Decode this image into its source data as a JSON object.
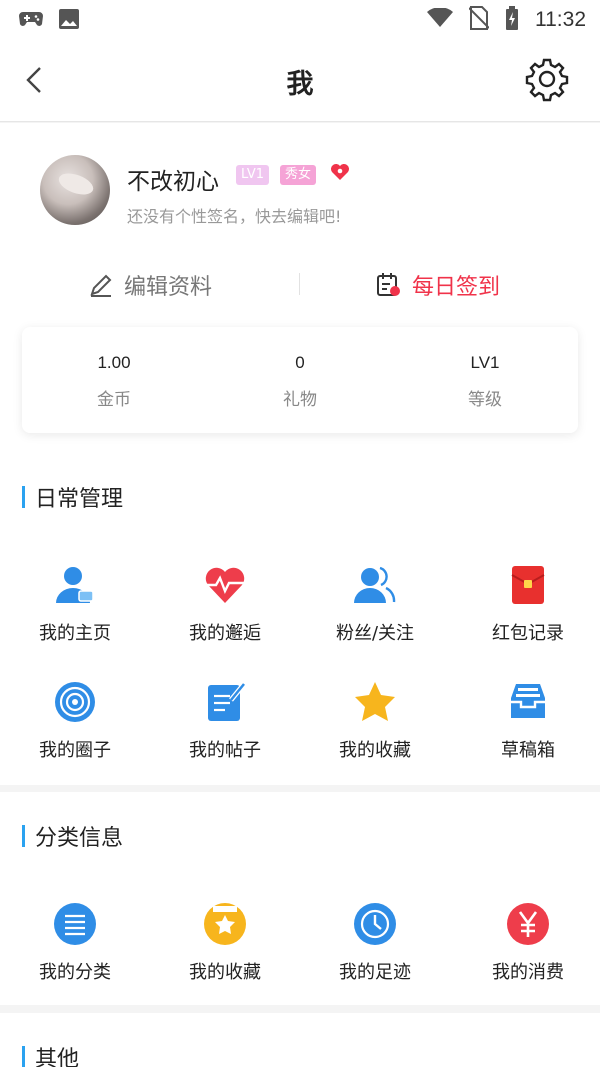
{
  "status_bar": {
    "time": "11:32"
  },
  "header": {
    "title": "我"
  },
  "profile": {
    "name": "不改初心",
    "level_badge": "LV1",
    "gender_badge": "秀女",
    "signature": "还没有个性签名，快去编辑吧!",
    "edit_label": "编辑资料",
    "checkin_label": "每日签到",
    "stats": [
      {
        "value": "1.00",
        "label": "金币"
      },
      {
        "value": "0",
        "label": "礼物"
      },
      {
        "value": "LV1",
        "label": "等级"
      }
    ]
  },
  "daily": {
    "title": "日常管理",
    "items": [
      {
        "label": "我的主页",
        "icon": "user-home-icon"
      },
      {
        "label": "我的邂逅",
        "icon": "heartbeat-icon"
      },
      {
        "label": "粉丝/关注",
        "icon": "fans-icon"
      },
      {
        "label": "红包记录",
        "icon": "red-packet-icon"
      },
      {
        "label": "我的圈子",
        "icon": "circle-icon"
      },
      {
        "label": "我的帖子",
        "icon": "post-icon"
      },
      {
        "label": "我的收藏",
        "icon": "star-icon"
      },
      {
        "label": "草稿箱",
        "icon": "drafts-icon"
      }
    ]
  },
  "category": {
    "title": "分类信息",
    "items": [
      {
        "label": "我的分类",
        "icon": "list-icon"
      },
      {
        "label": "我的收藏",
        "icon": "favorite-icon"
      },
      {
        "label": "我的足迹",
        "icon": "clock-icon"
      },
      {
        "label": "我的消费",
        "icon": "yuan-icon"
      }
    ]
  },
  "other": {
    "title": "其他"
  },
  "colors": {
    "accent": "#2aa2f0",
    "checkin": "#f0334a"
  }
}
